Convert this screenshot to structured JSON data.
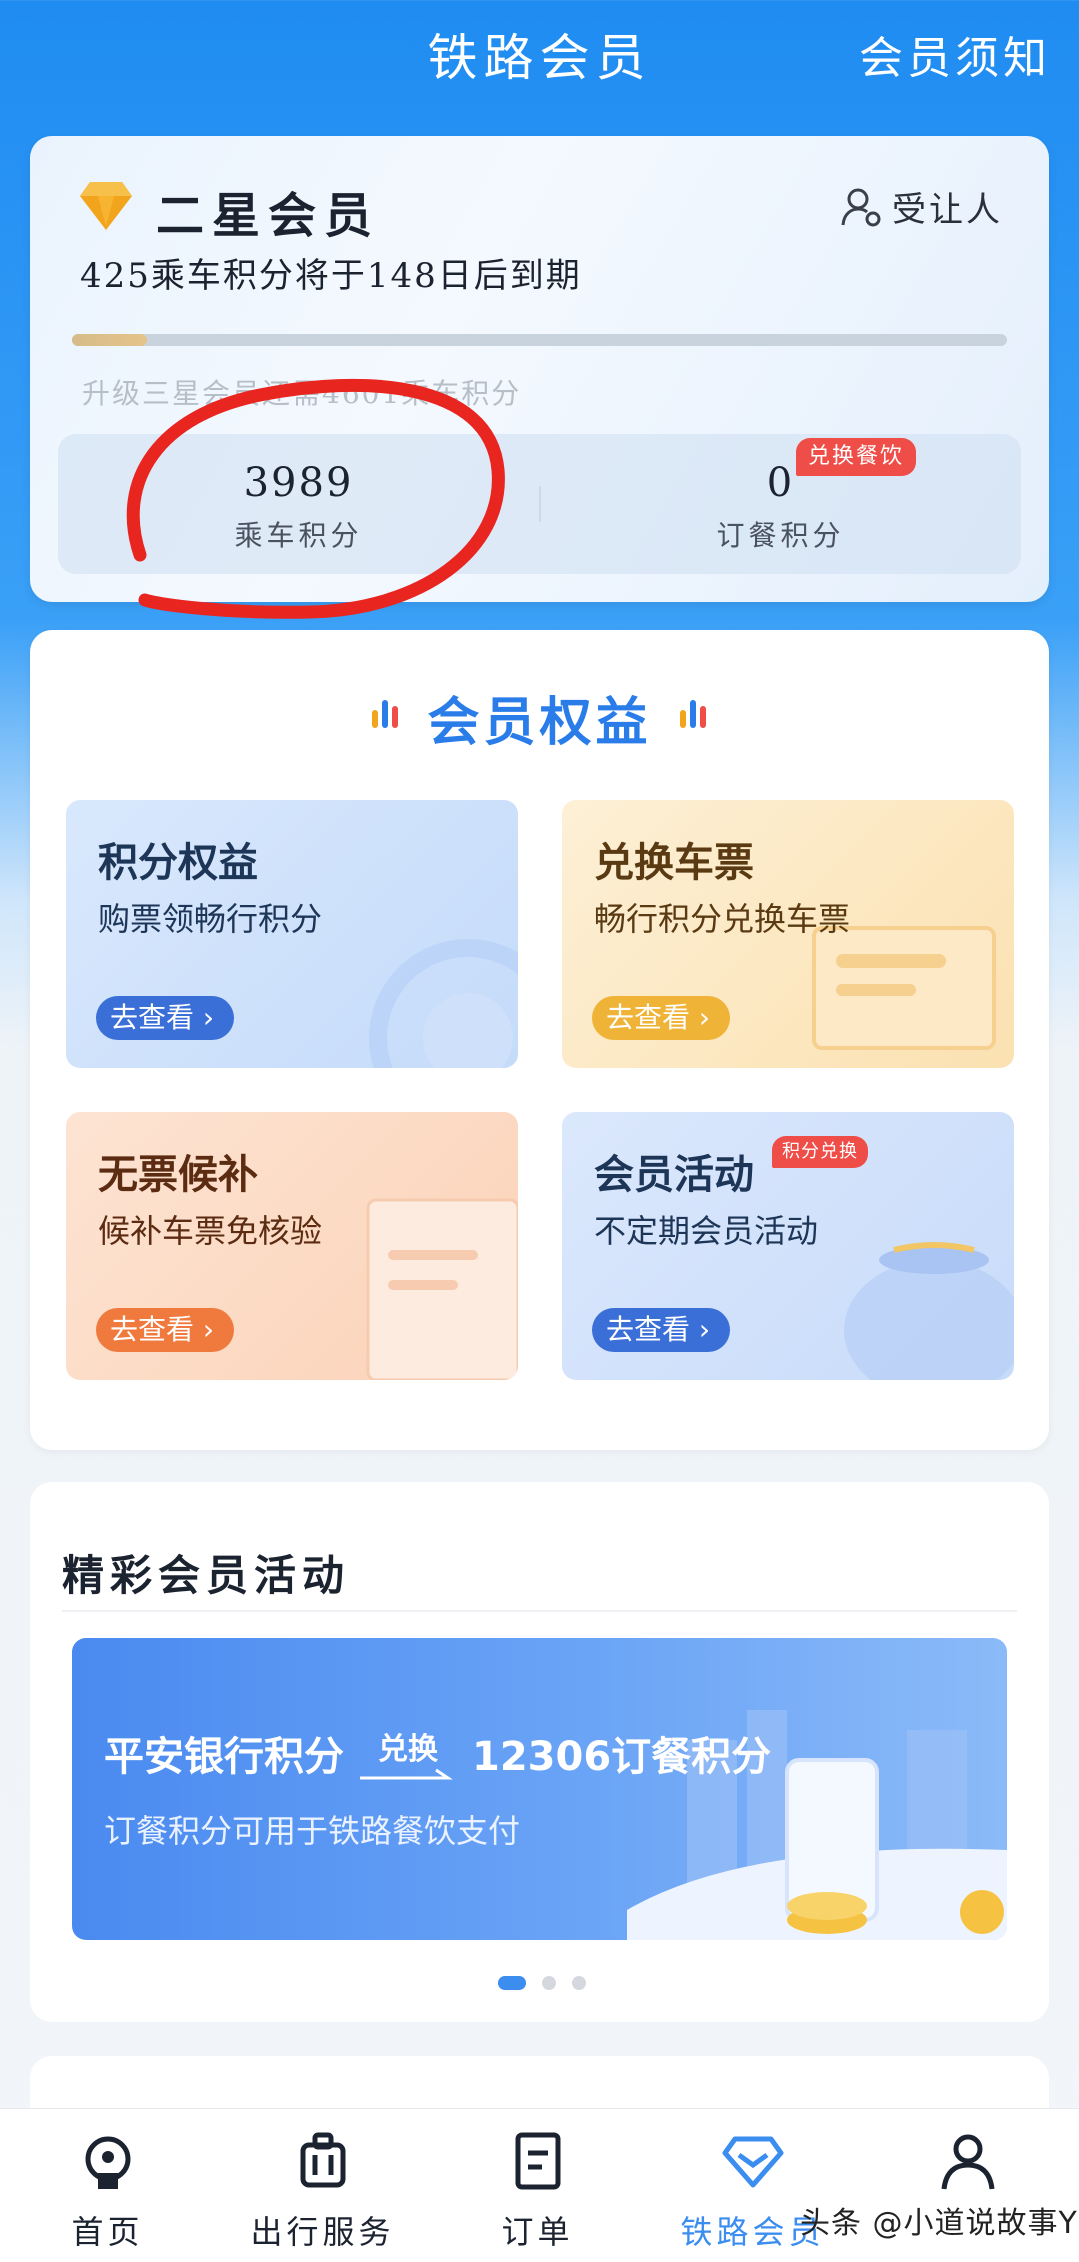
{
  "header": {
    "title": "铁路会员",
    "notice_label": "会员须知"
  },
  "member_card": {
    "level_name": "二星会员",
    "transferee_label": "受让人",
    "expiry_text": "425乘车积分将于148日后到期",
    "progress_fraction": 0.08,
    "upgrade_hint": "升级三星会员还需4601乘车积分",
    "ride_points": {
      "value": "3989",
      "label": "乘车积分"
    },
    "meal_points": {
      "value": "0",
      "label": "订餐积分"
    },
    "exchange_badge": "兑换餐饮"
  },
  "benefits": {
    "title": "会员权益",
    "tiles": [
      {
        "title": "积分权益",
        "subtitle": "购票领畅行积分",
        "button": "去查看"
      },
      {
        "title": "兑换车票",
        "subtitle": "畅行积分兑换车票",
        "button": "去查看"
      },
      {
        "title": "无票候补",
        "subtitle": "候补车票免核验",
        "button": "去查看"
      },
      {
        "title": "会员活动",
        "subtitle": "不定期会员活动",
        "button": "去查看",
        "badge": "积分兑换"
      }
    ]
  },
  "activities": {
    "title": "精彩会员活动",
    "banner": {
      "source": "平安银行积分",
      "action": "兑换",
      "target": "12306订餐积分",
      "subtitle": "订餐积分可用于铁路餐饮支付"
    },
    "page_count": 3,
    "active_page": 1
  },
  "bottom_nav": {
    "items": [
      {
        "label": "首页",
        "icon": "railway-logo-icon"
      },
      {
        "label": "出行服务",
        "icon": "luggage-icon"
      },
      {
        "label": "订单",
        "icon": "order-icon"
      },
      {
        "label": "铁路会员",
        "icon": "diamond-icon"
      },
      {
        "label": "我的",
        "icon": "person-icon"
      }
    ],
    "active_index": 3
  },
  "watermark": "头条 @小道说故事Y",
  "colors": {
    "primary": "#2a7de9",
    "header_bg": "#1f8cf2",
    "badge_red": "#ef4d48",
    "annotation_red": "#e8251f"
  }
}
